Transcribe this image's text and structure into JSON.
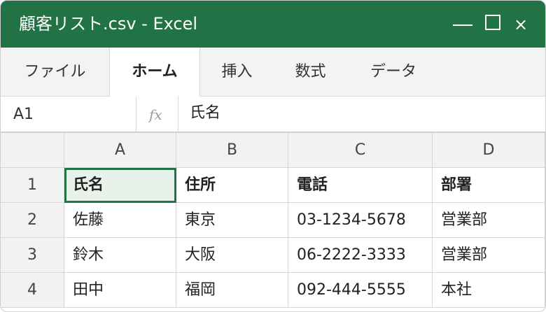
{
  "window": {
    "title": "顧客リスト.csv - Excel",
    "controls": {
      "minimize": "—",
      "maximize": "☐",
      "close": "×"
    },
    "accent_color": "#217346"
  },
  "ribbon": {
    "tabs": [
      {
        "label": "ファイル",
        "active": false
      },
      {
        "label": "ホーム",
        "active": true
      },
      {
        "label": "挿入",
        "active": false
      },
      {
        "label": "数式",
        "active": false
      },
      {
        "label": "データ",
        "active": false
      }
    ]
  },
  "formula_bar": {
    "name_box": "A1",
    "fx_label": "fx",
    "content": "氏名"
  },
  "sheet": {
    "columns": [
      "A",
      "B",
      "C",
      "D"
    ],
    "rows": [
      {
        "num": "1",
        "cells": [
          "氏名",
          "住所",
          "電話",
          "部署"
        ]
      },
      {
        "num": "2",
        "cells": [
          "佐藤",
          "東京",
          "03-1234-5678",
          "営業部"
        ]
      },
      {
        "num": "3",
        "cells": [
          "鈴木",
          "大阪",
          "06-2222-3333",
          "営業部"
        ]
      },
      {
        "num": "4",
        "cells": [
          "田中",
          "福岡",
          "092-444-5555",
          "本社"
        ]
      }
    ],
    "selected_cell": "A1"
  }
}
